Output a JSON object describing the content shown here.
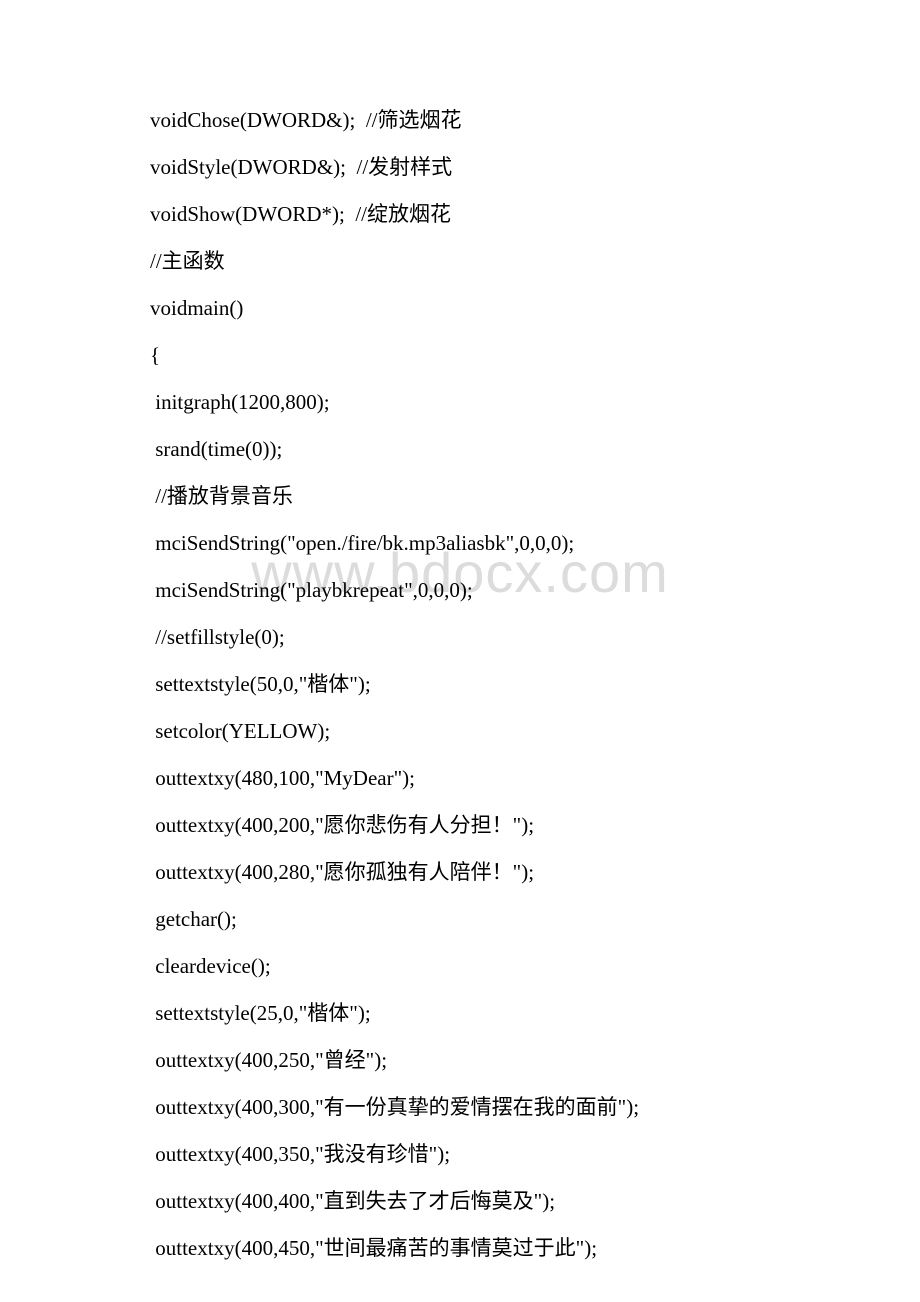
{
  "watermark": "www.bdocx.com",
  "lines": [
    {
      "text": "voidChose(DWORD&);  //筛选烟花",
      "indent": false
    },
    {
      "text": "voidStyle(DWORD&);  //发射样式",
      "indent": false
    },
    {
      "text": "voidShow(DWORD*);  //绽放烟花",
      "indent": false
    },
    {
      "text": "//主函数",
      "indent": false
    },
    {
      "text": "voidmain()",
      "indent": false
    },
    {
      "text": "{",
      "indent": false
    },
    {
      "text": " initgraph(1200,800);",
      "indent": false
    },
    {
      "text": " srand(time(0));",
      "indent": false
    },
    {
      "text": " //播放背景音乐",
      "indent": false
    },
    {
      "text": " mciSendString(\"open./fire/bk.mp3aliasbk\",0,0,0);",
      "indent": false
    },
    {
      "text": " mciSendString(\"playbkrepeat\",0,0,0);",
      "indent": false
    },
    {
      "text": " //setfillstyle(0);",
      "indent": false
    },
    {
      "text": " settextstyle(50,0,\"楷体\");",
      "indent": false
    },
    {
      "text": " setcolor(YELLOW);",
      "indent": false
    },
    {
      "text": " outtextxy(480,100,\"MyDear\");",
      "indent": false
    },
    {
      "text": " outtextxy(400,200,\"愿你悲伤有人分担！\");",
      "indent": false
    },
    {
      "text": " outtextxy(400,280,\"愿你孤独有人陪伴！\");",
      "indent": false
    },
    {
      "text": " getchar();",
      "indent": false
    },
    {
      "text": " cleardevice();",
      "indent": false
    },
    {
      "text": " settextstyle(25,0,\"楷体\");",
      "indent": false
    },
    {
      "text": " outtextxy(400,250,\"曾经\");",
      "indent": false
    },
    {
      "text": " outtextxy(400,300,\"有一份真挚的爱情摆在我的面前\");",
      "indent": false
    },
    {
      "text": " outtextxy(400,350,\"我没有珍惜\");",
      "indent": false
    },
    {
      "text": " outtextxy(400,400,\"直到失去了才后悔莫及\");",
      "indent": false
    },
    {
      "text": " outtextxy(400,450,\"世间最痛苦的事情莫过于此\");",
      "indent": false
    }
  ]
}
